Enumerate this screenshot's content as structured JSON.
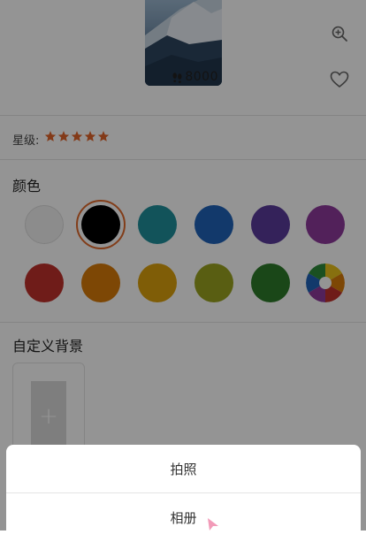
{
  "preview": {
    "steps_value": "8000",
    "steps_icon": "footprints-icon"
  },
  "actions": {
    "zoom_icon": "zoom-in-icon",
    "favorite_icon": "heart-icon"
  },
  "rating": {
    "label": "星级:",
    "stars": 5,
    "star_color": "#e2652a"
  },
  "colors": {
    "title": "颜色",
    "swatches": [
      {
        "name": "white",
        "hex": "#f2f2f2"
      },
      {
        "name": "black",
        "hex": "#000000",
        "selected": true
      },
      {
        "name": "teal",
        "hex": "#1f8f9b"
      },
      {
        "name": "blue",
        "hex": "#1f63b8"
      },
      {
        "name": "purple",
        "hex": "#5b3c9c"
      },
      {
        "name": "magenta",
        "hex": "#8e3a9c"
      },
      {
        "name": "red",
        "hex": "#c0312b"
      },
      {
        "name": "orange",
        "hex": "#d77a0a"
      },
      {
        "name": "yellow",
        "hex": "#dba10d"
      },
      {
        "name": "olive",
        "hex": "#99a31f"
      },
      {
        "name": "green",
        "hex": "#2d7b2a"
      },
      {
        "name": "multicolor",
        "hex": "multi"
      }
    ],
    "selection_ring": "#e06a2c"
  },
  "custom_background": {
    "title": "自定义背景",
    "add_symbol": "+"
  },
  "action_sheet": {
    "options": [
      "拍照",
      "相册"
    ]
  }
}
